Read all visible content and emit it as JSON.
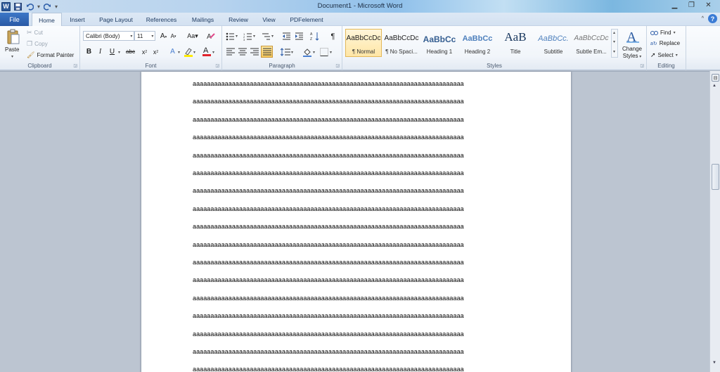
{
  "window": {
    "title": "Document1 - Microsoft Word",
    "app_icon": "word-icon"
  },
  "quick_access": [
    "save-icon",
    "undo-icon",
    "redo-icon",
    "customize-icon"
  ],
  "tabs": [
    {
      "label": "File"
    },
    {
      "label": "Home"
    },
    {
      "label": "Insert"
    },
    {
      "label": "Page Layout"
    },
    {
      "label": "References"
    },
    {
      "label": "Mailings"
    },
    {
      "label": "Review"
    },
    {
      "label": "View"
    },
    {
      "label": "PDFelement"
    }
  ],
  "ribbon": {
    "clipboard": {
      "label": "Clipboard",
      "paste": "Paste",
      "cut": "Cut",
      "copy": "Copy",
      "format_painter": "Format Painter"
    },
    "font": {
      "label": "Font",
      "name": "Calibri (Body)",
      "size": "11"
    },
    "paragraph": {
      "label": "Paragraph"
    },
    "styles": {
      "label": "Styles",
      "items": [
        {
          "preview": "AaBbCcDc",
          "name": "¶ Normal"
        },
        {
          "preview": "AaBbCcDc",
          "name": "¶ No Spaci..."
        },
        {
          "preview": "AaBbCc",
          "name": "Heading 1"
        },
        {
          "preview": "AaBbCc",
          "name": "Heading 2"
        },
        {
          "preview": "AaB",
          "name": "Title"
        },
        {
          "preview": "AaBbCc.",
          "name": "Subtitle"
        },
        {
          "preview": "AaBbCcDc",
          "name": "Subtle Em..."
        }
      ],
      "change_styles_line1": "Change",
      "change_styles_line2": "Styles"
    },
    "editing": {
      "label": "Editing",
      "find": "Find",
      "replace": "Replace",
      "select": "Select"
    }
  },
  "document": {
    "lines": [
      "aaaaaaaaaaaaaaaaaaaaaaaaaaaaaaaaaaaaaaaaaaaaaaaaaaaaaaaaaaaaaaaaaaaaaaaaaaaa",
      "aaaaaaaaaaaaaaaaaaaaaaaaaaaaaaaaaaaaaaaaaaaaaaaaaaaaaaaaaaaaaaaaaaaaaaaaaaaa",
      "aaaaaaaaaaaaaaaaaaaaaaaaaaaaaaaaaaaaaaaaaaaaaaaaaaaaaaaaaaaaaaaaaaaaaaaaaaaa",
      "aaaaaaaaaaaaaaaaaaaaaaaaaaaaaaaaaaaaaaaaaaaaaaaaaaaaaaaaaaaaaaaaaaaaaaaaaaaa",
      "aaaaaaaaaaaaaaaaaaaaaaaaaaaaaaaaaaaaaaaaaaaaaaaaaaaaaaaaaaaaaaaaaaaaaaaaaaaa",
      "aaaaaaaaaaaaaaaaaaaaaaaaaaaaaaaaaaaaaaaaaaaaaaaaaaaaaaaaaaaaaaaaaaaaaaaaaaaa",
      "aaaaaaaaaaaaaaaaaaaaaaaaaaaaaaaaaaaaaaaaaaaaaaaaaaaaaaaaaaaaaaaaaaaaaaaaaaaa",
      "aaaaaaaaaaaaaaaaaaaaaaaaaaaaaaaaaaaaaaaaaaaaaaaaaaaaaaaaaaaaaaaaaaaaaaaaaaaa",
      "aaaaaaaaaaaaaaaaaaaaaaaaaaaaaaaaaaaaaaaaaaaaaaaaaaaaaaaaaaaaaaaaaaaaaaaaaaaa",
      "aaaaaaaaaaaaaaaaaaaaaaaaaaaaaaaaaaaaaaaaaaaaaaaaaaaaaaaaaaaaaaaaaaaaaaaaaaaa",
      "aaaaaaaaaaaaaaaaaaaaaaaaaaaaaaaaaaaaaaaaaaaaaaaaaaaaaaaaaaaaaaaaaaaaaaaaaaaa",
      "aaaaaaaaaaaaaaaaaaaaaaaaaaaaaaaaaaaaaaaaaaaaaaaaaaaaaaaaaaaaaaaaaaaaaaaaaaaa",
      "aaaaaaaaaaaaaaaaaaaaaaaaaaaaaaaaaaaaaaaaaaaaaaaaaaaaaaaaaaaaaaaaaaaaaaaaaaaa",
      "aaaaaaaaaaaaaaaaaaaaaaaaaaaaaaaaaaaaaaaaaaaaaaaaaaaaaaaaaaaaaaaaaaaaaaaaaaaa",
      "aaaaaaaaaaaaaaaaaaaaaaaaaaaaaaaaaaaaaaaaaaaaaaaaaaaaaaaaaaaaaaaaaaaaaaaaaaaa",
      "aaaaaaaaaaaaaaaaaaaaaaaaaaaaaaaaaaaaaaaaaaaaaaaaaaaaaaaaaaaaaaaaaaaaaaaaaaaa",
      "aaaaaaaaaaaaaaaaaaaaaaaaaaaaaaaaaaaaaaaaaaaaaaaaaaaaaaaaaaaaaaaaaaaaaaaaaaaa"
    ]
  },
  "colors": {
    "file_tab": "#2a5aa6",
    "accent": "#3a7bd5",
    "selected_style": "#ffe6a6",
    "workspace": "#bcc5d1"
  }
}
